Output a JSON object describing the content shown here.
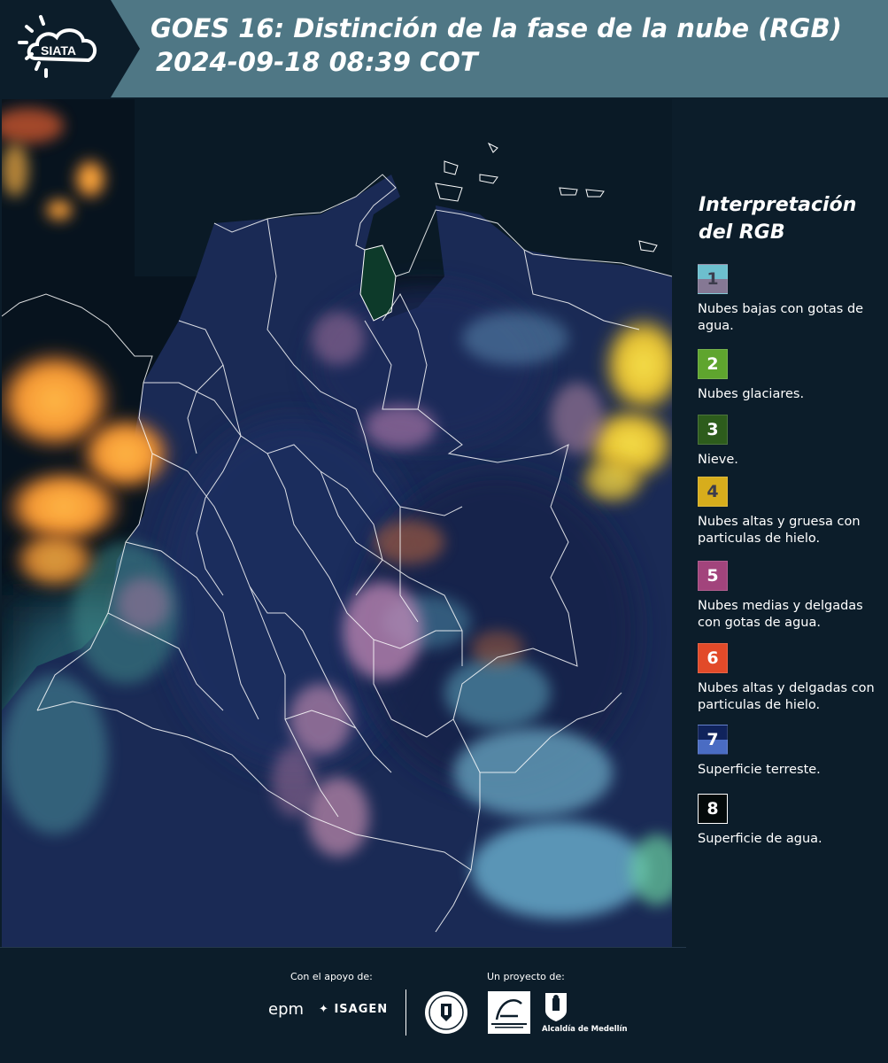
{
  "header": {
    "logo_text": "SIATA",
    "title": "GOES 16: Distinción de la fase de la nube (RGB)",
    "timestamp": "2024-09-18 08:39 COT",
    "background_color": "#4f7785"
  },
  "map": {
    "description_icon": "satellite-rgb-map",
    "ocean_color": "#07131e",
    "land_color": "#1c2a52",
    "border_color": "#ffffff"
  },
  "legend": {
    "title": "Interpretación del RGB",
    "items": [
      {
        "number": "1",
        "label": "Nubes bajas con gotas de agua.",
        "color_top": "#6dbfce",
        "color_bottom": "#857894"
      },
      {
        "number": "2",
        "label": "Nubes glaciares.",
        "color_top": "#5fa52e",
        "color_bottom": "#5fa52e"
      },
      {
        "number": "3",
        "label": "Nieve.",
        "color_top": "#2d5c1c",
        "color_bottom": "#2d5c1c"
      },
      {
        "number": "4",
        "label": "Nubes altas y gruesa con particulas de hielo.",
        "color_top": "#d7ad1c",
        "color_bottom": "#d7ad1c"
      },
      {
        "number": "5",
        "label": "Nubes medias y delgadas con gotas de agua.",
        "color_top": "#a2447c",
        "color_bottom": "#a2447c"
      },
      {
        "number": "6",
        "label": "Nubes altas y delgadas con particulas de hielo.",
        "color_top": "#e24a29",
        "color_bottom": "#e24a29"
      },
      {
        "number": "7",
        "label": "Superficie terreste.",
        "color_top": "#10235c",
        "color_bottom": "#4a6cc3"
      },
      {
        "number": "8",
        "label": "Superficie de agua.",
        "color_top": "#040a0a",
        "color_bottom": "#040a0a"
      }
    ]
  },
  "footer": {
    "support_label": "Con el apoyo de:",
    "project_label": "Un proyecto de:",
    "sponsors": [
      "epm",
      "ISAGEN"
    ],
    "partners": [
      "Área Metropolitana Valle de Aburrá",
      "Alcaldía de Medellín"
    ],
    "alcaldia_label": "Alcaldía de Medellín",
    "epm_text": "epm",
    "isagen_text": "ISAGEN"
  }
}
